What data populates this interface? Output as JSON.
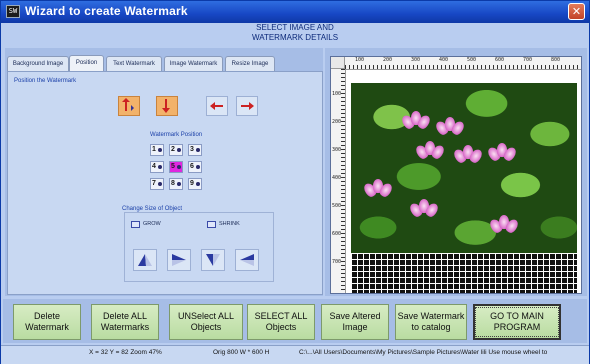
{
  "window": {
    "title": "Wizard to create Watermark",
    "icon": "app-icon-letters",
    "icon_text": "SW"
  },
  "header": {
    "line1": "SELECT IMAGE AND",
    "line2": "WATERMARK DETAILS"
  },
  "tabs": [
    {
      "label": "Background Image"
    },
    {
      "label": "Position",
      "active": true
    },
    {
      "label": "Text Watermark"
    },
    {
      "label": "Image Watermark"
    },
    {
      "label": "Resize Image"
    }
  ],
  "position_tab": {
    "section_label": "Position the Watermark",
    "watermark_position_label": "Watermark Position",
    "position_grid": [
      "1",
      "2",
      "3",
      "4",
      "5",
      "6",
      "7",
      "8",
      "9"
    ],
    "selected_position": "5",
    "change_size_label": "Change Size of Object",
    "grow_label": "GROW",
    "shrink_label": "SHRINK"
  },
  "canvas": {
    "top_ruler": [
      "100",
      "200",
      "300",
      "400",
      "500",
      "600",
      "700",
      "800"
    ],
    "left_ruler": [
      "100",
      "200",
      "300",
      "400",
      "500",
      "600",
      "700"
    ]
  },
  "buttons": {
    "delete_watermark": "Delete Watermark",
    "delete_all": "Delete ALL Watermarks",
    "unselect_all": "UNSelect  ALL Objects",
    "select_all": "SELECT ALL Objects",
    "save_altered": "Save Altered Image",
    "save_catalog": "Save Watermark to catalog",
    "goto_main": "GO TO MAIN PROGRAM"
  },
  "status": {
    "coords": "X = 32 Y = 82 Zoom 47%",
    "orig": "Orig 800 W * 600 H",
    "path": "C:\\...\\All Users\\Documents\\My Pictures\\Sample Pictures\\Water lili Use mouse wheel to"
  },
  "colors": {
    "title_bar": "#1747c4",
    "selected_position": "#e028e0",
    "button_green": "#c6e4b0"
  }
}
